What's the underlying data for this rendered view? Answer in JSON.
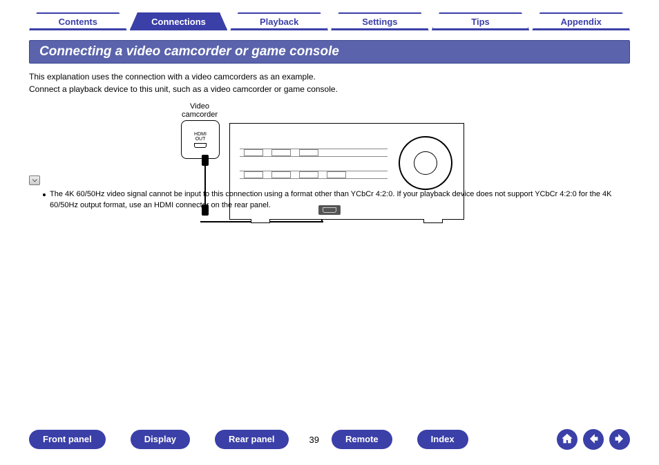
{
  "tabs": [
    {
      "label": "Contents",
      "active": false
    },
    {
      "label": "Connections",
      "active": true
    },
    {
      "label": "Playback",
      "active": false
    },
    {
      "label": "Settings",
      "active": false
    },
    {
      "label": "Tips",
      "active": false
    },
    {
      "label": "Appendix",
      "active": false
    }
  ],
  "heading": "Connecting a video camcorder or game console",
  "body_lines": [
    "This explanation uses the connection with a video camcorders as an example.",
    "Connect a playback device to this unit, such as a video camcorder or game console."
  ],
  "diagram": {
    "camcorder_label_line1": "Video",
    "camcorder_label_line2": "camcorder",
    "hdmi_label_line1": "HDMI",
    "hdmi_label_line2": "OUT"
  },
  "notes": [
    "The 4K 60/50Hz video signal cannot be input to this connection using a format other than YCbCr 4:2:0. If your playback device does not support YCbCr 4:2:0 for the 4K 60/50Hz output format, use an HDMI connector on the rear panel."
  ],
  "footer": {
    "buttons": [
      "Front panel",
      "Display",
      "Rear panel"
    ],
    "page": "39",
    "buttons_right": [
      "Remote",
      "Index"
    ]
  }
}
